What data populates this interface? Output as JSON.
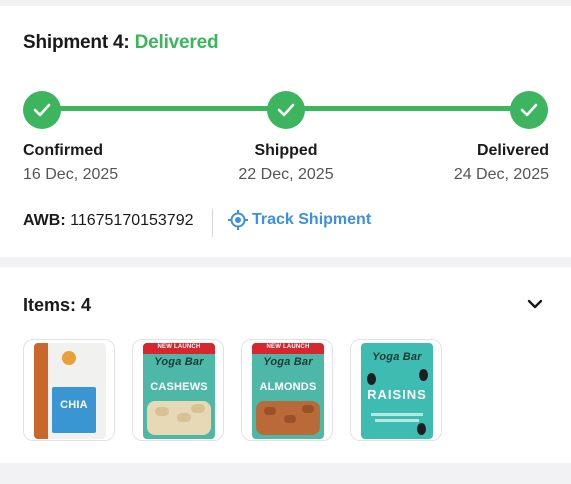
{
  "shipment": {
    "title_prefix": "Shipment 4:",
    "status": "Delivered",
    "status_color": "#3cb55e",
    "steps": [
      {
        "label": "Confirmed",
        "date": "16 Dec, 2025",
        "icon": "check-icon"
      },
      {
        "label": "Shipped",
        "date": "22 Dec, 2025",
        "icon": "check-icon"
      },
      {
        "label": "Delivered",
        "date": "24 Dec, 2025",
        "icon": "check-icon"
      }
    ],
    "awb_label": "AWB:",
    "awb_value": "11675170153792",
    "track_label": "Track Shipment",
    "track_icon": "locate-target-icon",
    "link_color": "#3d8fe0"
  },
  "items": {
    "title": "Items: 4",
    "toggle_icon": "chevron-down-icon",
    "products": [
      {
        "name": "CHIA",
        "icon": "chia-seed-pack-image"
      },
      {
        "name": "CASHEWS",
        "banner": "NEW LAUNCH",
        "brand": "Yoga Bar",
        "icon": "cashews-pack-image"
      },
      {
        "name": "ALMONDS",
        "banner": "NEW LAUNCH",
        "brand": "Yoga Bar",
        "icon": "almonds-pack-image"
      },
      {
        "name": "RAISINS",
        "brand": "Yoga Bar",
        "icon": "raisins-pack-image"
      }
    ]
  }
}
